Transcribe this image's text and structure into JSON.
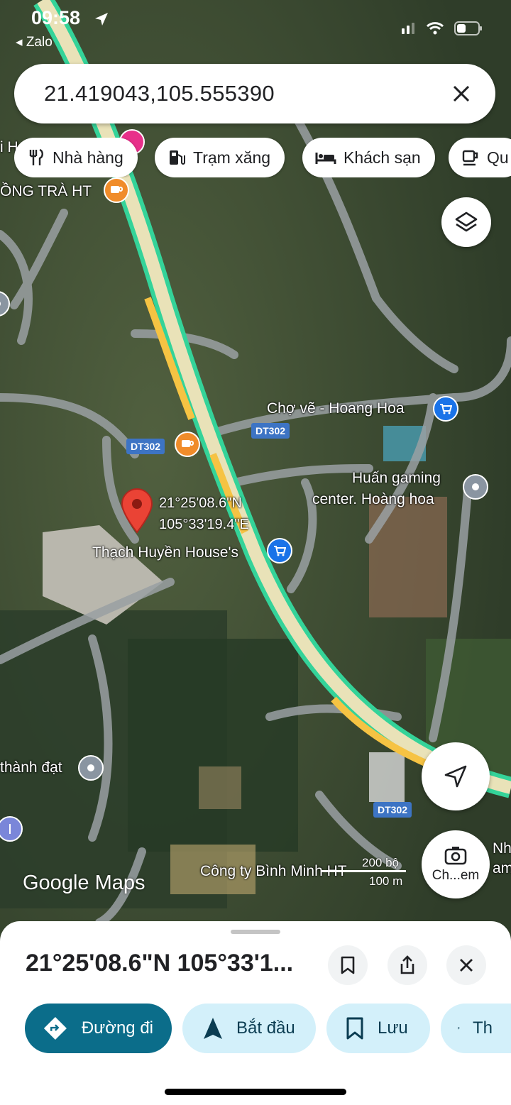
{
  "status_bar": {
    "time": "09:58",
    "back_app": "◂ Zalo"
  },
  "search": {
    "query": "21.419043,105.555390"
  },
  "chips": [
    {
      "label": "Nhà hàng",
      "icon": "restaurant-icon"
    },
    {
      "label": "Trạm xăng",
      "icon": "gas-station-icon"
    },
    {
      "label": "Khách sạn",
      "icon": "hotel-icon"
    },
    {
      "label": "Qu",
      "icon": "coffee-icon"
    }
  ],
  "map": {
    "pin": {
      "lat": "21°25'08.6\"N",
      "lng": "105°33'19.4\"E"
    },
    "labels": {
      "tra": "ỒNG TRÀ HT",
      "cho_ve": "Chợ vẽ - Hoang Hoa",
      "huan_1": "Huấn gaming",
      "huan_2": "center. Hoàng hoa",
      "thach_huyen": "Thạch Huyền House's",
      "thanh_dat": "thành đạt",
      "binh_minh": "Công ty Bình Minh HT",
      "top_left": "i H",
      "right_nh": "Nh",
      "right_am": "am"
    },
    "road_shields": [
      "DT302",
      "DT302",
      "DT302"
    ],
    "logo": "Google Maps",
    "scale": {
      "imperial": "200 bộ",
      "metric": "100 m"
    },
    "street_view_label": "Ch...em"
  },
  "sheet": {
    "title": "21°25'08.6\"N 105°33'1...",
    "actions": [
      {
        "label": "Đường đi",
        "icon": "directions-icon"
      },
      {
        "label": "Bắt đầu",
        "icon": "navigation-arrow-icon"
      },
      {
        "label": "Lưu",
        "icon": "bookmark-icon"
      },
      {
        "label": "Th",
        "icon": "flag-icon"
      }
    ]
  },
  "colors": {
    "route_green": "#34d399",
    "road_yellow": "#f6c343",
    "primary": "#0b6d8a",
    "chip_bg": "#ffffff",
    "shield": "#3d74c4"
  }
}
